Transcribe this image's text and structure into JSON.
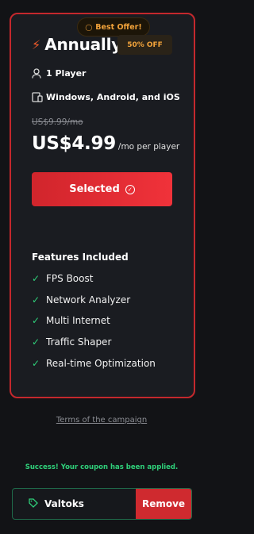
{
  "offer_badge": {
    "label": "Best Offer!",
    "icon": "star-circle-icon"
  },
  "plan": {
    "icon": "lightning-icon",
    "title": "Annually",
    "discount": "50% OFF",
    "players": "1 Player",
    "platforms": "Windows, Android, and iOS",
    "old_price": "US$9.99/mo",
    "price": "US$4.99",
    "per_unit": "/mo per player",
    "button_label": "Selected"
  },
  "features": {
    "title": "Features Included",
    "items": [
      "FPS Boost",
      "Network Analyzer",
      "Multi Internet",
      "Traffic Shaper",
      "Real-time Optimization"
    ]
  },
  "terms_link": "Terms of the campaign",
  "coupon": {
    "success_message": "Success! Your coupon has been applied.",
    "code": "Valtoks",
    "remove_label": "Remove"
  },
  "colors": {
    "accent_red": "#e42f36",
    "success_green": "#2fd07a",
    "badge_orange": "#f2a33a",
    "background": "#121316"
  }
}
